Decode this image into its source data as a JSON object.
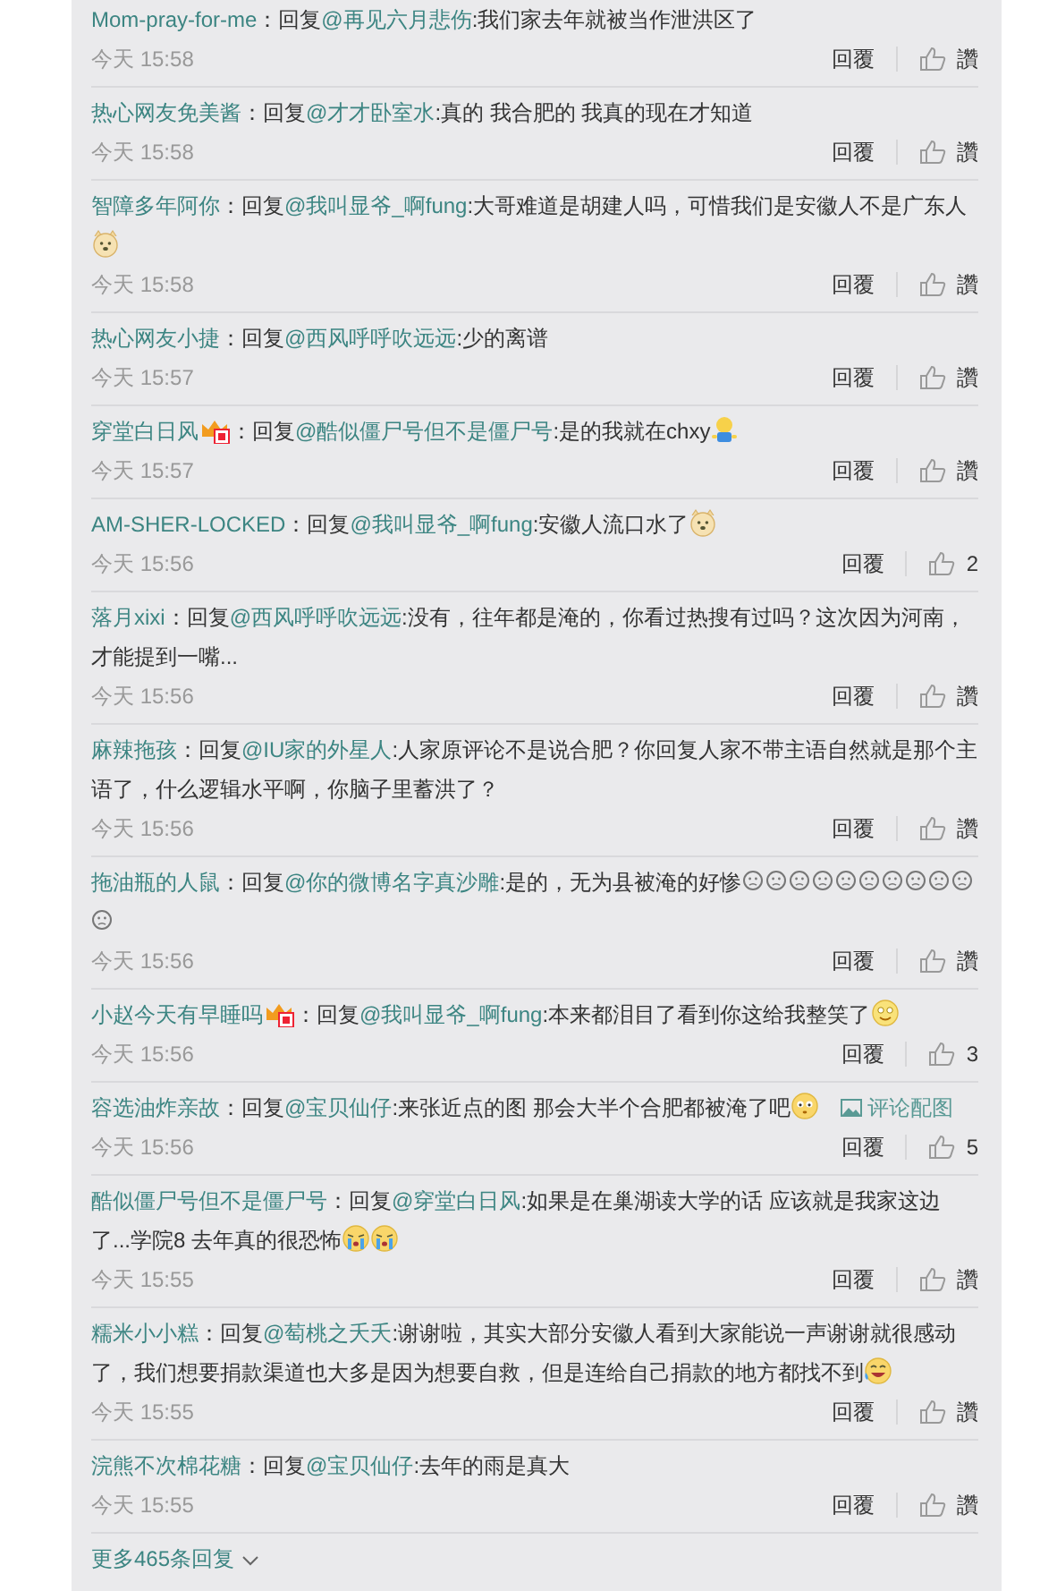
{
  "comments": [
    {
      "author": "Mom-pray-for-me",
      "badge": false,
      "body": [
        {
          "kind": "text",
          "text": "：回复"
        },
        {
          "kind": "mention",
          "text": "@再见六月悲伤"
        },
        {
          "kind": "text",
          "text": ":我们家去年就被当作泄洪区了"
        }
      ],
      "time": "今天 15:58",
      "reply": "回覆",
      "likes": "讚"
    },
    {
      "author": "热心网友免美酱",
      "badge": false,
      "body": [
        {
          "kind": "text",
          "text": "：回复"
        },
        {
          "kind": "mention",
          "text": "@才才卧室水"
        },
        {
          "kind": "text",
          "text": ":真的 我合肥的 我真的现在才知道"
        }
      ],
      "time": "今天 15:58",
      "reply": "回覆",
      "likes": "讚"
    },
    {
      "author": "智障多年阿你",
      "badge": false,
      "body": [
        {
          "kind": "text",
          "text": "：回复"
        },
        {
          "kind": "mention",
          "text": "@我叫显爷_啊fung"
        },
        {
          "kind": "text",
          "text": ":大哥难道是胡建人吗，可惜我们是安徽人不是广东人"
        },
        {
          "kind": "doge"
        }
      ],
      "time": "今天 15:58",
      "reply": "回覆",
      "likes": "讚"
    },
    {
      "author": "热心网友小捷",
      "badge": false,
      "body": [
        {
          "kind": "text",
          "text": "：回复"
        },
        {
          "kind": "mention",
          "text": "@西风呼呼吹远远"
        },
        {
          "kind": "text",
          "text": ":少的离谱"
        }
      ],
      "time": "今天 15:57",
      "reply": "回覆",
      "likes": "讚"
    },
    {
      "author": "穿堂白日风",
      "badge": true,
      "body": [
        {
          "kind": "text",
          "text": "：回复"
        },
        {
          "kind": "mention",
          "text": "@酷似僵尸号但不是僵尸号"
        },
        {
          "kind": "text",
          "text": ":是的我就在chxy"
        },
        {
          "kind": "figure"
        }
      ],
      "time": "今天 15:57",
      "reply": "回覆",
      "likes": "讚"
    },
    {
      "author": "AM-SHER-LOCKED",
      "badge": false,
      "body": [
        {
          "kind": "text",
          "text": "：回复"
        },
        {
          "kind": "mention",
          "text": "@我叫显爷_啊fung"
        },
        {
          "kind": "text",
          "text": ":安徽人流口水了"
        },
        {
          "kind": "doge"
        }
      ],
      "time": "今天 15:56",
      "reply": "回覆",
      "likes": "2"
    },
    {
      "author": "落月xixi",
      "badge": false,
      "body": [
        {
          "kind": "text",
          "text": "：回复"
        },
        {
          "kind": "mention",
          "text": "@西风呼呼吹远远"
        },
        {
          "kind": "text",
          "text": ":没有，往年都是淹的，你看过热搜有过吗？这次因为河南，才能提到一嘴..."
        }
      ],
      "time": "今天 15:56",
      "reply": "回覆",
      "likes": "讚"
    },
    {
      "author": "麻辣拖孩",
      "badge": false,
      "body": [
        {
          "kind": "text",
          "text": "：回复"
        },
        {
          "kind": "mention",
          "text": "@IU家的外星人"
        },
        {
          "kind": "text",
          "text": ":人家原评论不是说合肥？你回复人家不带主语自然就是那个主语了，什么逻辑水平啊，你脑子里蓄洪了？"
        }
      ],
      "time": "今天 15:56",
      "reply": "回覆",
      "likes": "讚"
    },
    {
      "author": "拖油瓶的人鼠",
      "badge": false,
      "body": [
        {
          "kind": "text",
          "text": "：回复"
        },
        {
          "kind": "mention",
          "text": "@你的微博名字真沙雕"
        },
        {
          "kind": "text",
          "text": ":是的，无为县被淹的好惨"
        },
        {
          "kind": "sad"
        },
        {
          "kind": "sad"
        },
        {
          "kind": "sad"
        },
        {
          "kind": "sad"
        },
        {
          "kind": "sad"
        },
        {
          "kind": "sad"
        },
        {
          "kind": "sad"
        },
        {
          "kind": "sad"
        },
        {
          "kind": "sad"
        },
        {
          "kind": "sad"
        },
        {
          "kind": "sad"
        }
      ],
      "time": "今天 15:56",
      "reply": "回覆",
      "likes": "讚"
    },
    {
      "author": "小赵今天有早睡吗",
      "badge": true,
      "body": [
        {
          "kind": "text",
          "text": "：回复"
        },
        {
          "kind": "mention",
          "text": "@我叫显爷_啊fung"
        },
        {
          "kind": "text",
          "text": ":本来都泪目了看到你这给我整笑了"
        },
        {
          "kind": "smile"
        }
      ],
      "time": "今天 15:56",
      "reply": "回覆",
      "likes": "3"
    },
    {
      "author": "容选油炸亲故",
      "badge": false,
      "body": [
        {
          "kind": "text",
          "text": "：回复"
        },
        {
          "kind": "mention",
          "text": "@宝贝仙仔"
        },
        {
          "kind": "text",
          "text": ":来张近点的图 那会大半个合肥都被淹了吧"
        },
        {
          "kind": "wide"
        }
      ],
      "attachment": "评论配图",
      "time": "今天 15:56",
      "reply": "回覆",
      "likes": "5"
    },
    {
      "author": "酷似僵尸号但不是僵尸号",
      "badge": false,
      "body": [
        {
          "kind": "text",
          "text": "：回复"
        },
        {
          "kind": "mention",
          "text": "@穿堂白日风"
        },
        {
          "kind": "text",
          "text": ":如果是在巢湖读大学的话 应该就是我家这边了...学院8 去年真的很恐怖"
        },
        {
          "kind": "cry"
        },
        {
          "kind": "cry"
        }
      ],
      "time": "今天 15:55",
      "reply": "回覆",
      "likes": "讚"
    },
    {
      "author": "糯米小小糕",
      "badge": false,
      "body": [
        {
          "kind": "text",
          "text": "：回复"
        },
        {
          "kind": "mention",
          "text": "@萄桃之夭夭"
        },
        {
          "kind": "text",
          "text": ":谢谢啦，其实大部分安徽人看到大家能说一声谢谢就很感动了，我们想要捐款渠道也大多是因为想要自救，但是连给自己捐款的地方都找不到"
        },
        {
          "kind": "laugh"
        }
      ],
      "time": "今天 15:55",
      "reply": "回覆",
      "likes": "讚"
    },
    {
      "author": "浣熊不次棉花糖",
      "badge": false,
      "body": [
        {
          "kind": "text",
          "text": "：回复"
        },
        {
          "kind": "mention",
          "text": "@宝贝仙仔"
        },
        {
          "kind": "text",
          "text": ":去年的雨是真大"
        }
      ],
      "time": "今天 15:55",
      "reply": "回覆",
      "likes": "讚"
    }
  ],
  "more": "更多465条回复"
}
